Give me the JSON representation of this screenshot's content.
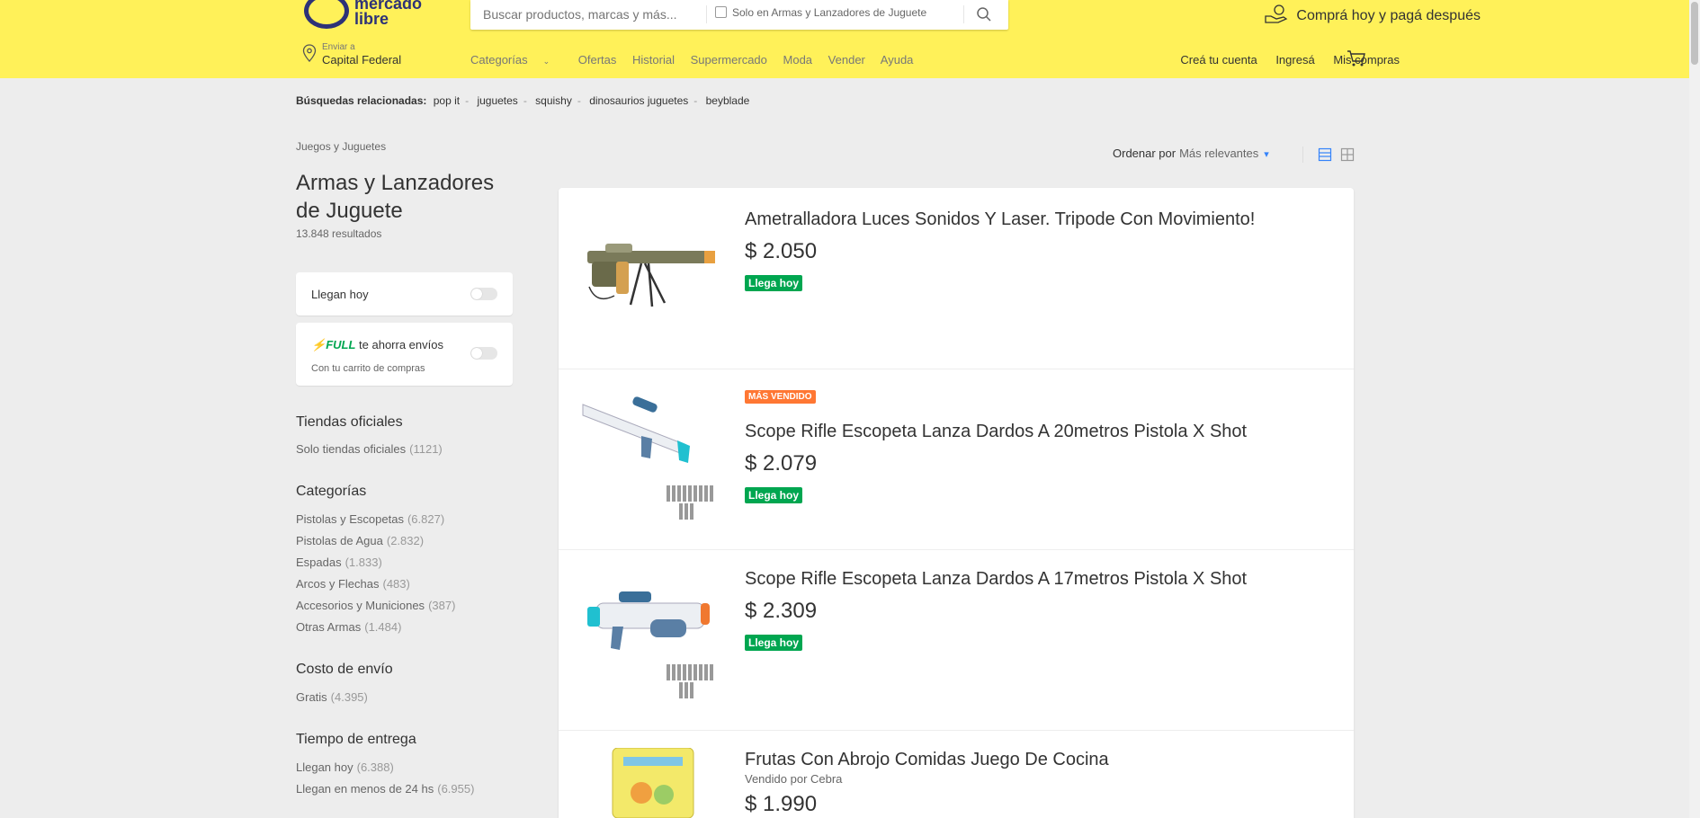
{
  "header": {
    "logo_line1": "mercado",
    "logo_line2": "libre",
    "search_placeholder": "Buscar productos, marcas y más...",
    "search_filter_label": "Solo en Armas y Lanzadores de Juguete",
    "promo_text": "Comprá hoy y pagá después",
    "location_label": "Enviar a",
    "location_value": "Capital Federal",
    "nav": [
      "Categorías",
      "Ofertas",
      "Historial",
      "Supermercado",
      "Moda",
      "Vender",
      "Ayuda"
    ],
    "user_nav": [
      "Creá tu cuenta",
      "Ingresá",
      "Mis compras"
    ]
  },
  "related": {
    "label": "Búsquedas relacionadas:",
    "terms": [
      "pop it",
      "juguetes",
      "squishy",
      "dinosaurios juguetes",
      "beyblade"
    ]
  },
  "breadcrumb": "Juegos y Juguetes",
  "page_title": "Armas y Lanzadores de Juguete",
  "results_count": "13.848 resultados",
  "filters": {
    "arrive_today": "Llegan hoy",
    "full_badge": "FULL",
    "full_text": "te ahorra envíos",
    "full_sub": "Con tu carrito de compras"
  },
  "sections": {
    "official": {
      "title": "Tiendas oficiales",
      "items": [
        {
          "label": "Solo tiendas oficiales",
          "count": "(1121)"
        }
      ]
    },
    "categories": {
      "title": "Categorías",
      "items": [
        {
          "label": "Pistolas y Escopetas",
          "count": "(6.827)"
        },
        {
          "label": "Pistolas de Agua",
          "count": "(2.832)"
        },
        {
          "label": "Espadas",
          "count": "(1.833)"
        },
        {
          "label": "Arcos y Flechas",
          "count": "(483)"
        },
        {
          "label": "Accesorios y Municiones",
          "count": "(387)"
        },
        {
          "label": "Otras Armas",
          "count": "(1.484)"
        }
      ]
    },
    "shipping": {
      "title": "Costo de envío",
      "items": [
        {
          "label": "Gratis",
          "count": "(4.395)"
        }
      ]
    },
    "delivery": {
      "title": "Tiempo de entrega",
      "items": [
        {
          "label": "Llegan hoy",
          "count": "(6.388)"
        },
        {
          "label": "Llegan en menos de 24 hs",
          "count": "(6.955)"
        }
      ]
    }
  },
  "sort": {
    "label": "Ordenar por",
    "value": "Más relevantes"
  },
  "items": [
    {
      "title": "Ametralladora Luces Sonidos Y Laser. Tripode Con Movimiento!",
      "price": "$ 2.050",
      "shipping": "Llega hoy"
    },
    {
      "highlight": "MÁS VENDIDO",
      "title": "Scope Rifle Escopeta Lanza Dardos A 20metros Pistola X Shot",
      "price": "$ 2.079",
      "shipping": "Llega hoy"
    },
    {
      "title": "Scope Rifle Escopeta Lanza Dardos A 17metros Pistola X Shot",
      "price": "$ 2.309",
      "shipping": "Llega hoy"
    },
    {
      "title": "Frutas Con Abrojo Comidas Juego De Cocina",
      "seller": "Vendido por Cebra",
      "price": "$ 1.990"
    }
  ],
  "colors": {
    "header_bg": "#fff159",
    "page_bg": "#ededed",
    "accent_blue": "#3483fa",
    "shipping_green": "#00a650",
    "highlight_orange": "#ff7733"
  },
  "icons": [
    "location-pin-icon",
    "search-icon",
    "hand-coin-icon",
    "cart-icon",
    "chevron-down-icon",
    "list-view-icon",
    "grid-view-icon",
    "lightning-icon"
  ]
}
